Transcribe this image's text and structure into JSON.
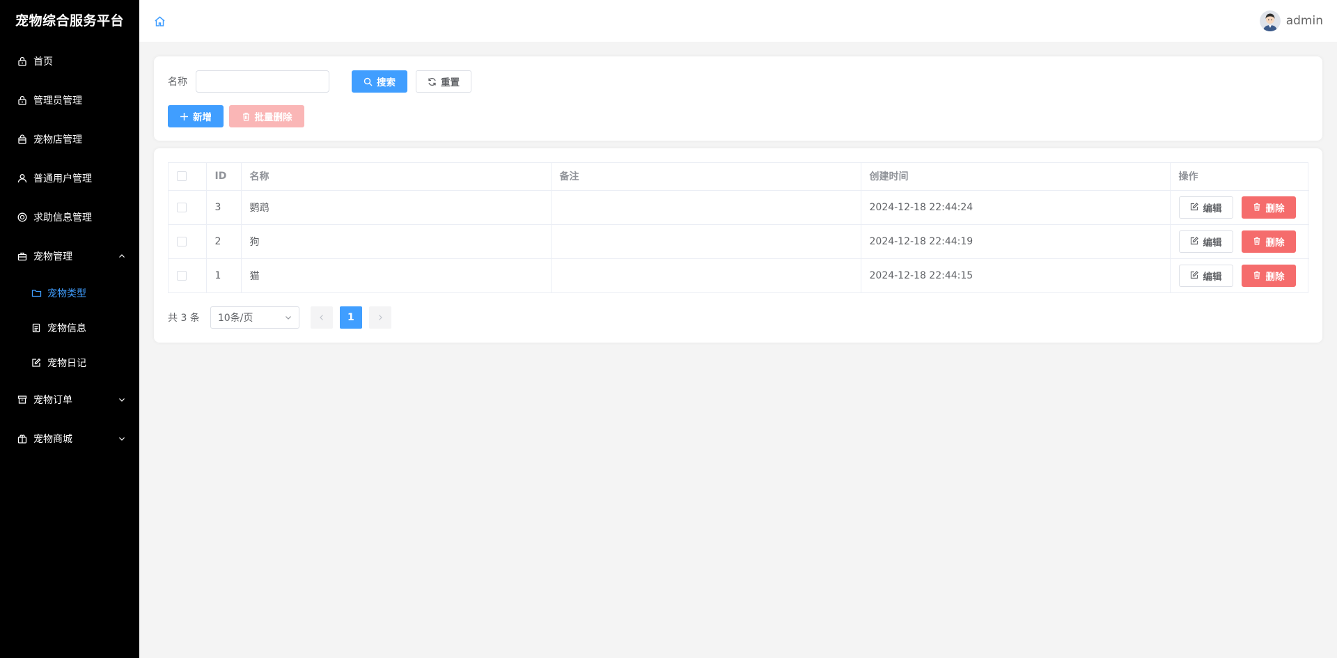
{
  "app": {
    "title": "宠物综合服务平台"
  },
  "sidebar": {
    "items": [
      {
        "label": "首页",
        "icon": "lock-icon"
      },
      {
        "label": "管理员管理",
        "icon": "lock-icon"
      },
      {
        "label": "宠物店管理",
        "icon": "shopping-bag-icon"
      },
      {
        "label": "普通用户管理",
        "icon": "user-icon"
      },
      {
        "label": "求助信息管理",
        "icon": "help-ring-icon"
      },
      {
        "label": "宠物管理",
        "icon": "briefcase-icon",
        "expanded": true,
        "children": [
          {
            "label": "宠物类型",
            "icon": "folder-icon",
            "active": true
          },
          {
            "label": "宠物信息",
            "icon": "document-icon"
          },
          {
            "label": "宠物日记",
            "icon": "edit-icon"
          }
        ]
      },
      {
        "label": "宠物订单",
        "icon": "box-icon",
        "expanded": false
      },
      {
        "label": "宠物商城",
        "icon": "present-icon",
        "expanded": false
      }
    ]
  },
  "header": {
    "username": "admin"
  },
  "search": {
    "name_label": "名称",
    "name_value": "",
    "search_label": "搜索",
    "reset_label": "重置",
    "add_label": "新增",
    "batch_delete_label": "批量删除"
  },
  "table": {
    "columns": [
      "ID",
      "名称",
      "备注",
      "创建时间",
      "操作"
    ],
    "rows": [
      {
        "id": "3",
        "name": "鹦鹉",
        "remark": "",
        "created": "2024-12-18 22:44:24"
      },
      {
        "id": "2",
        "name": "狗",
        "remark": "",
        "created": "2024-12-18 22:44:19"
      },
      {
        "id": "1",
        "name": "猫",
        "remark": "",
        "created": "2024-12-18 22:44:15"
      }
    ],
    "edit_label": "编辑",
    "delete_label": "删除"
  },
  "pagination": {
    "total_text": "共 3 条",
    "page_size": "10条/页",
    "current_page": "1"
  },
  "colors": {
    "primary": "#409eff",
    "danger": "#f56c6c",
    "danger_disabled": "#fab6b6",
    "sidebar_bg": "#000000"
  }
}
